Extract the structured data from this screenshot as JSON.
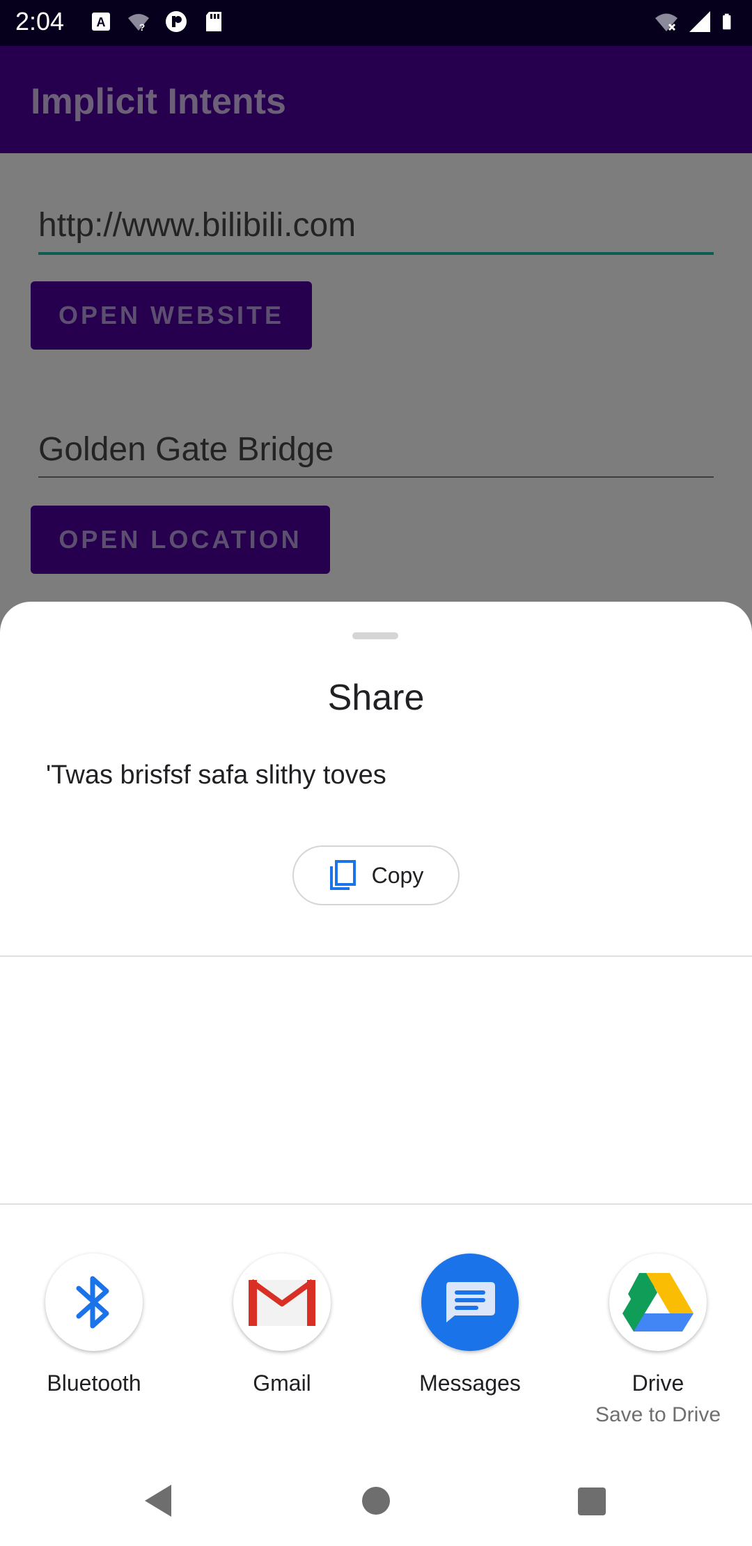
{
  "status_bar": {
    "time": "2:04",
    "left_icons": [
      "text-notification-icon",
      "wifi-question-icon",
      "app-notification-icon",
      "sd-card-icon"
    ],
    "right_icons": [
      "wifi-off-icon",
      "cell-signal-icon",
      "battery-icon"
    ]
  },
  "app_bar": {
    "title": "Implicit Intents"
  },
  "content": {
    "url_field_value": "http://www.bilibili.com",
    "open_website_label": "OPEN WEBSITE",
    "location_field_value": "Golden Gate Bridge",
    "open_location_label": "OPEN LOCATION"
  },
  "share_sheet": {
    "title": "Share",
    "shared_text": "'Twas brisfsf safa slithy toves",
    "copy_label": "Copy",
    "targets": [
      {
        "label": "Bluetooth",
        "icon": "bluetooth-icon",
        "color": "#1a73e8"
      },
      {
        "label": "Gmail",
        "icon": "gmail-icon",
        "color": "#d93025"
      },
      {
        "label": "Messages",
        "icon": "messages-icon",
        "color": "#1a73e8"
      },
      {
        "label": "Drive",
        "sublabel": "Save to Drive",
        "icon": "drive-icon",
        "color": "#34a853"
      }
    ]
  },
  "nav_bar": {
    "icons": [
      "back-icon",
      "home-icon",
      "recents-icon"
    ]
  },
  "colors": {
    "status_bar": "#07001d",
    "app_bar": "#26004e",
    "scrim_background": "#7d7d7d",
    "accent_underline": "#0f5c55"
  }
}
